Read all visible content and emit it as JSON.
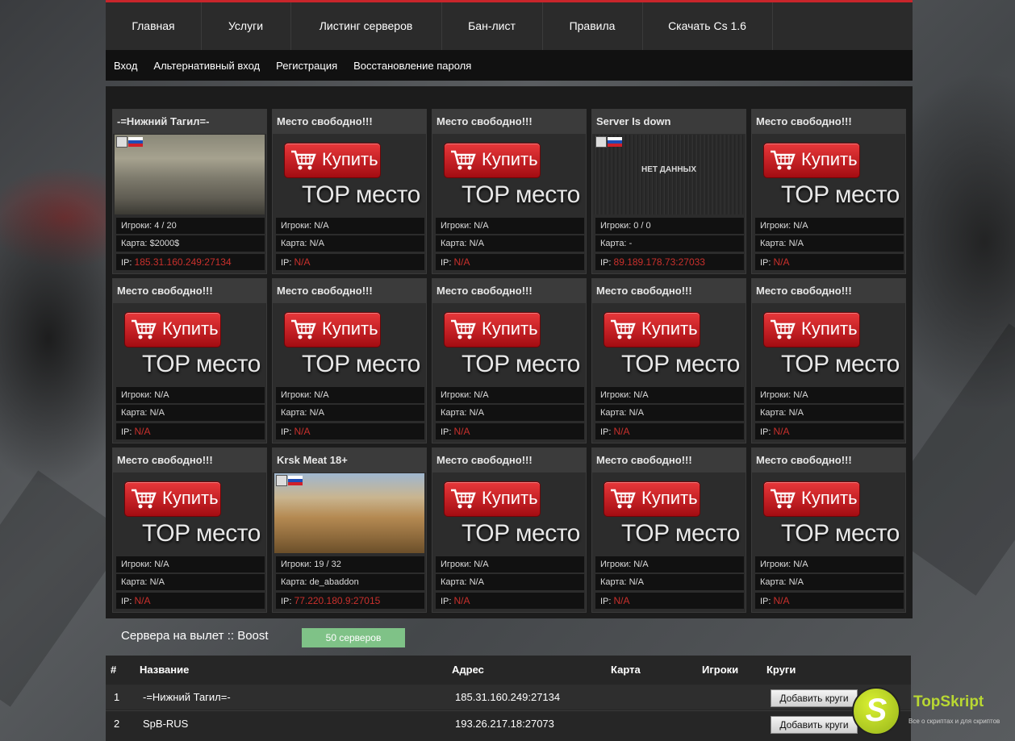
{
  "nav": {
    "items": [
      "Главная",
      "Услуги",
      "Листинг серверов",
      "Бан-лист",
      "Правила",
      "Скачать Cs 1.6"
    ]
  },
  "subnav": {
    "items": [
      "Вход",
      "Альтернативный вход",
      "Регистрация",
      "Восстановление пароля"
    ]
  },
  "labels": {
    "players": "Игроки:",
    "map": "Карта:",
    "ip": "IP:",
    "buy": "Купить",
    "top_place": "TOP место",
    "no_data": "НЕТ ДАННЫХ"
  },
  "cards": [
    {
      "title": "-=Нижний Тагил=-",
      "kind": "server",
      "thumb": "map-dust",
      "players": "4 / 20",
      "map": "$2000$",
      "ip": "185.31.160.249:27134"
    },
    {
      "title": "Место свободно!!!",
      "kind": "ad",
      "players": "N/A",
      "map": "N/A",
      "ip": "N/A"
    },
    {
      "title": "Место свободно!!!",
      "kind": "ad",
      "players": "N/A",
      "map": "N/A",
      "ip": "N/A"
    },
    {
      "title": "Server Is down",
      "kind": "server",
      "thumb": "nodata",
      "players": "0 / 0",
      "map": "-",
      "ip": "89.189.178.73:27033"
    },
    {
      "title": "Место свободно!!!",
      "kind": "ad",
      "players": "N/A",
      "map": "N/A",
      "ip": "N/A"
    },
    {
      "title": "Место свободно!!!",
      "kind": "ad",
      "players": "N/A",
      "map": "N/A",
      "ip": "N/A"
    },
    {
      "title": "Место свободно!!!",
      "kind": "ad",
      "players": "N/A",
      "map": "N/A",
      "ip": "N/A"
    },
    {
      "title": "Место свободно!!!",
      "kind": "ad",
      "players": "N/A",
      "map": "N/A",
      "ip": "N/A"
    },
    {
      "title": "Место свободно!!!",
      "kind": "ad",
      "players": "N/A",
      "map": "N/A",
      "ip": "N/A"
    },
    {
      "title": "Место свободно!!!",
      "kind": "ad",
      "players": "N/A",
      "map": "N/A",
      "ip": "N/A"
    },
    {
      "title": "Место свободно!!!",
      "kind": "ad",
      "players": "N/A",
      "map": "N/A",
      "ip": "N/A"
    },
    {
      "title": "Krsk Meat 18+",
      "kind": "server",
      "thumb": "map-abaddon",
      "players": "19 / 32",
      "map": "de_abaddon",
      "ip": "77.220.180.9:27015"
    },
    {
      "title": "Место свободно!!!",
      "kind": "ad",
      "players": "N/A",
      "map": "N/A",
      "ip": "N/A"
    },
    {
      "title": "Место свободно!!!",
      "kind": "ad",
      "players": "N/A",
      "map": "N/A",
      "ip": "N/A"
    },
    {
      "title": "Место свободно!!!",
      "kind": "ad",
      "players": "N/A",
      "map": "N/A",
      "ip": "N/A"
    }
  ],
  "boost": {
    "title": "Сервера на вылет :: Boost",
    "badge": "50 серверов"
  },
  "table": {
    "headers": [
      "#",
      "Название",
      "Адрес",
      "Карта",
      "Игроки",
      "Круги"
    ],
    "rows": [
      {
        "num": "1",
        "name": "-=Нижний Тагил=-",
        "address": "185.31.160.249:27134",
        "map": "",
        "players": "",
        "button": "Добавить круги"
      },
      {
        "num": "2",
        "name": "SpB-RUS",
        "address": "193.26.217.18:27073",
        "map": "",
        "players": "",
        "button": "Добавить круги"
      }
    ]
  },
  "logo": {
    "letter": "S",
    "brand": "TopSkript",
    "tagline": "Все о скриптах и для скриптов"
  },
  "colors": {
    "accent_red": "#c8252b",
    "ip_red": "#c9302c",
    "badge_green": "#7fc287",
    "logo_lime": "#b9d832"
  }
}
